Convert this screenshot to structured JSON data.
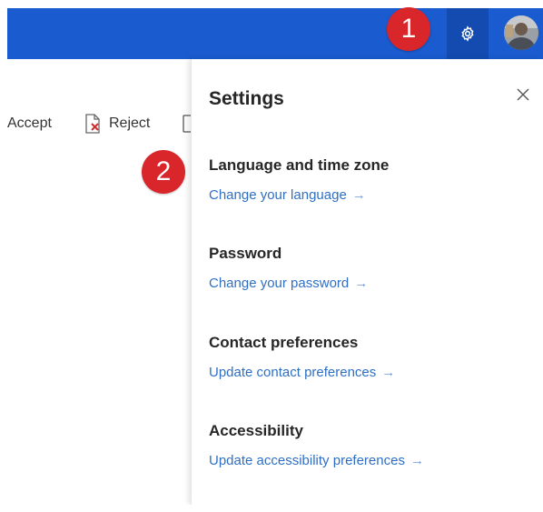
{
  "annotations": {
    "badge_1": "1",
    "badge_2": "2"
  },
  "header": {
    "settings_icon": "gear-icon",
    "avatar": "user-avatar",
    "bar_color": "#1a5bcf"
  },
  "toolbar": {
    "accept_label": "Accept",
    "reject_label": "Reject"
  },
  "settings": {
    "title": "Settings",
    "close_icon": "close-icon",
    "sections": [
      {
        "title": "Language and time zone",
        "link": "Change your language"
      },
      {
        "title": "Password",
        "link": "Change your password"
      },
      {
        "title": "Contact preferences",
        "link": "Update contact preferences"
      },
      {
        "title": "Accessibility",
        "link": "Update accessibility preferences"
      }
    ],
    "link_color": "#2f6fc4"
  }
}
